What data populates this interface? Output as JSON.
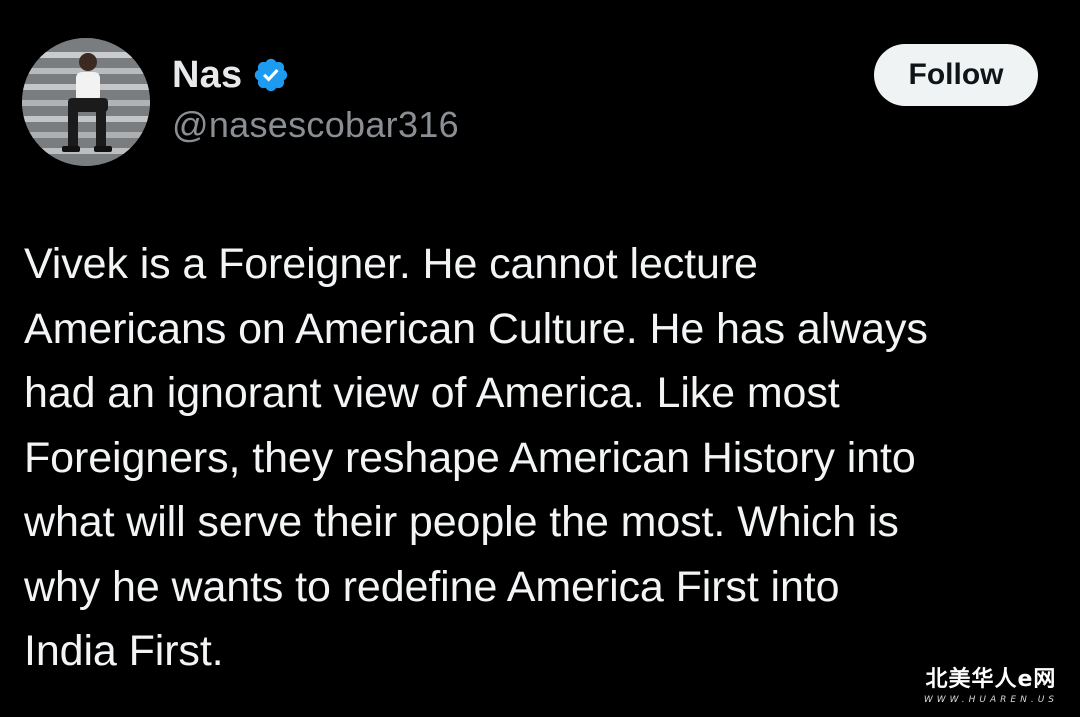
{
  "tweet": {
    "author": {
      "display_name": "Nas",
      "handle": "@nasescobar316",
      "verified": true,
      "avatar_icon": "profile-photo"
    },
    "follow_label": "Follow",
    "text": "Vivek is a Foreigner. He cannot lecture\nAmericans on American Culture. He has always\nhad an ignorant view of America. Like most\nForeigners, they reshape American History into\nwhat will serve their people the most. Which is\nwhy he wants to redefine America First into\nIndia First."
  },
  "watermark": {
    "title": "北美华人e网",
    "url": "WWW.HUAREN.US"
  },
  "colors": {
    "background": "#000000",
    "text_primary": "#e7e9ea",
    "text_secondary": "#8b8f94",
    "verified_badge": "#1d9bf0",
    "follow_button_bg": "#eff3f4"
  }
}
